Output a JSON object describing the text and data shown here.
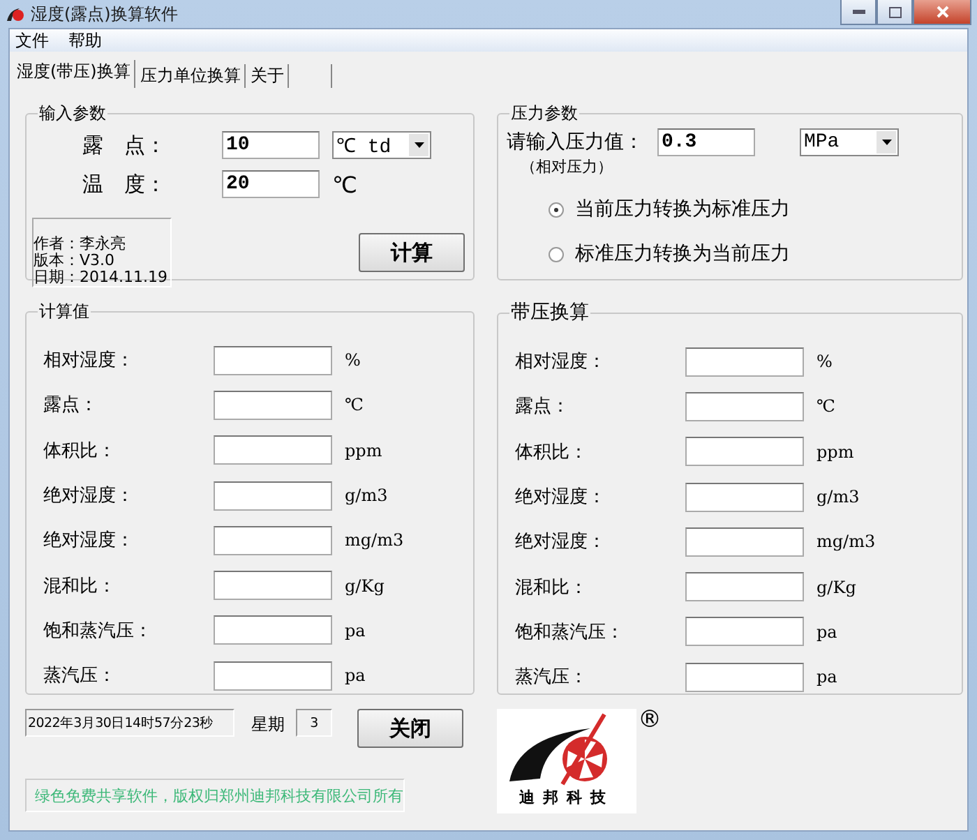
{
  "window": {
    "title": "湿度(露点)换算软件"
  },
  "menu": [
    "文件",
    "帮助"
  ],
  "tabs": [
    {
      "label": "湿度(带压)换算",
      "selected": true
    },
    {
      "label": "压力单位换算",
      "selected": false
    },
    {
      "label": "关于",
      "selected": false
    }
  ],
  "input_params": {
    "title": "输入参数",
    "fields": [
      {
        "label": "露　点：",
        "value": "10",
        "unit": "℃ td",
        "kind": "select"
      },
      {
        "label": "温　度：",
        "value": "20",
        "unit": "℃",
        "kind": "text"
      }
    ],
    "info": [
      "作者：李永亮",
      "版本：V3.0",
      "日期：2014.11.19"
    ],
    "calc_button": "计算"
  },
  "pressure_params": {
    "title": "压力参数",
    "label": "请输入压力值：",
    "value": "0.3",
    "unit": "MPa",
    "note": "（相对压力）",
    "options": [
      {
        "label": "当前压力转换为标准压力",
        "selected": true
      },
      {
        "label": "标准压力转换为当前压力",
        "selected": false
      }
    ]
  },
  "groups": [
    {
      "title": "计算值",
      "rows": [
        {
          "label": "相对湿度：",
          "unit": "%"
        },
        {
          "label": "露点：",
          "unit": "℃"
        },
        {
          "label": "体积比：",
          "unit": "ppm"
        },
        {
          "label": "绝对湿度：",
          "unit": "g/m3"
        },
        {
          "label": "绝对湿度：",
          "unit": "mg/m3"
        },
        {
          "label": "混和比：",
          "unit": "g/Kg"
        },
        {
          "label": "饱和蒸汽压：",
          "unit": "pa"
        },
        {
          "label": "蒸汽压：",
          "unit": "pa"
        }
      ]
    },
    {
      "title": "带压换算",
      "rows": [
        {
          "label": "相对湿度：",
          "unit": "%"
        },
        {
          "label": "露点：",
          "unit": "℃"
        },
        {
          "label": "体积比：",
          "unit": "ppm"
        },
        {
          "label": "绝对湿度：",
          "unit": "g/m3"
        },
        {
          "label": "绝对湿度：",
          "unit": "mg/m3"
        },
        {
          "label": "混和比：",
          "unit": "g/Kg"
        },
        {
          "label": "饱和蒸汽压：",
          "unit": "pa"
        },
        {
          "label": "蒸汽压：",
          "unit": "pa"
        }
      ]
    }
  ],
  "status": {
    "datetime": "2022年3月30日14时57分23秒",
    "weekday_label": "星期",
    "weekday": "3",
    "close_button": "关闭"
  },
  "footer": "绿色免费共享软件，版权归郑州迪邦科技有限公司所有",
  "logo": {
    "text": "迪邦科技",
    "mark": "®"
  }
}
